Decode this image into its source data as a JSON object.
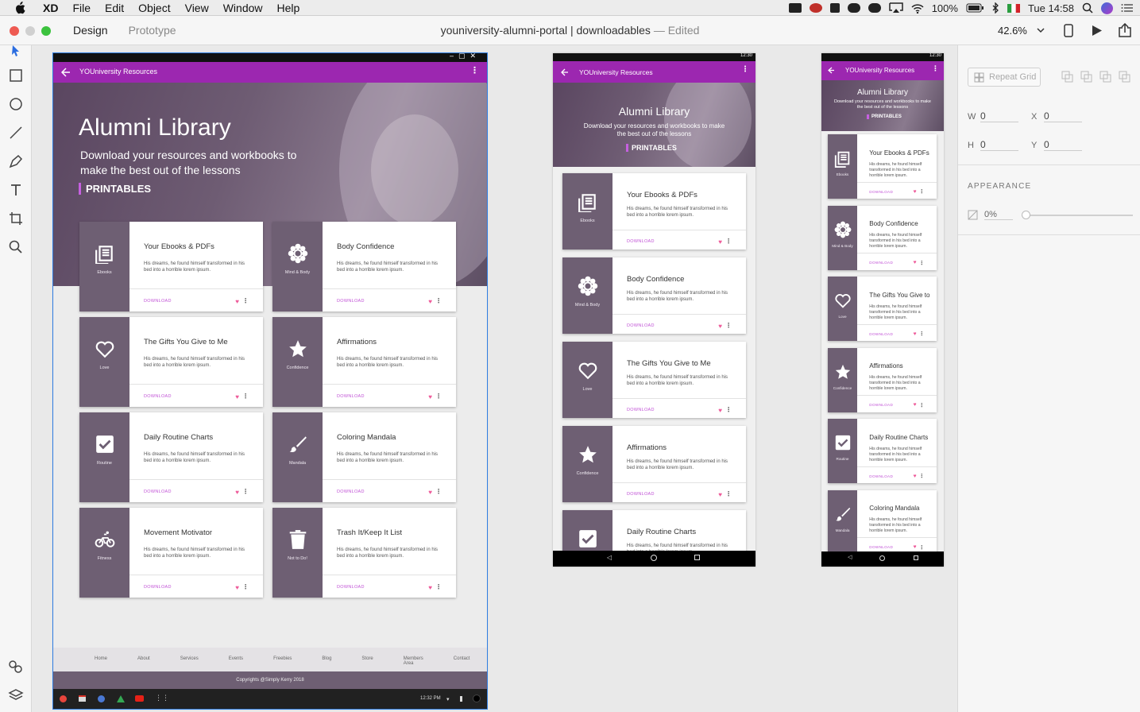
{
  "menubar": {
    "app": "XD",
    "items": [
      "File",
      "Edit",
      "Object",
      "View",
      "Window",
      "Help"
    ],
    "battery": "100%",
    "clock": "Tue 14:58"
  },
  "titlebar": {
    "tabs": [
      "Design",
      "Prototype"
    ],
    "doc_title": "youniversity-alumni-portal | downloadables",
    "status": "Edited",
    "zoom": "42.6%"
  },
  "rightpanel": {
    "repeat_grid": "Repeat Grid",
    "w": "0",
    "h": "0",
    "x": "0",
    "y": "0",
    "appearance": "APPEARANCE",
    "opacity": "0%"
  },
  "artboard": {
    "appbar_title": "YOUniversity Resources",
    "hero_title": "Alumni Library",
    "hero_sub": "Download your resources and workbooks to make the best out of the lessons",
    "chip": "PRINTABLES",
    "card_body": "His dreams, he found himself transformed in his bed into a horrible lorem ipsum.",
    "download": "DOWNLOAD",
    "cards": [
      {
        "title": "Your Ebooks & PDFs",
        "label": "Ebooks",
        "icon": "book-icon"
      },
      {
        "title": "Body Confidence",
        "label": "Mind & Body",
        "icon": "flower-icon"
      },
      {
        "title": "The Gifts You Give to Me",
        "label": "Love",
        "icon": "heart-outline-icon"
      },
      {
        "title": "Affirmations",
        "label": "Confidence",
        "icon": "star-icon"
      },
      {
        "title": "Daily Routine Charts",
        "label": "Routine",
        "icon": "checkbox-icon"
      },
      {
        "title": "Coloring Mandala",
        "label": "Mandala",
        "icon": "brush-icon"
      },
      {
        "title": "Movement Motivator",
        "label": "Fitness",
        "icon": "bike-icon"
      },
      {
        "title": "Trash It/Keep It List",
        "label": "Not to Do!",
        "icon": "trash-icon"
      }
    ],
    "footer_links": [
      "Home",
      "About",
      "Services",
      "Events",
      "Freebies",
      "Blog",
      "Store",
      "Members Area",
      "Contact"
    ],
    "copyright": "Copyrights @Simply Kerry 2018",
    "taskbar_time": "12:32 PM",
    "status_time": "12:30",
    "gifts_title_short": "The Gifts You Give to"
  },
  "colors": {
    "accent": "#9c27b0",
    "sidebar_tile": "#6e5f73",
    "heart": "#ee5b9a",
    "download": "#c152d6"
  }
}
